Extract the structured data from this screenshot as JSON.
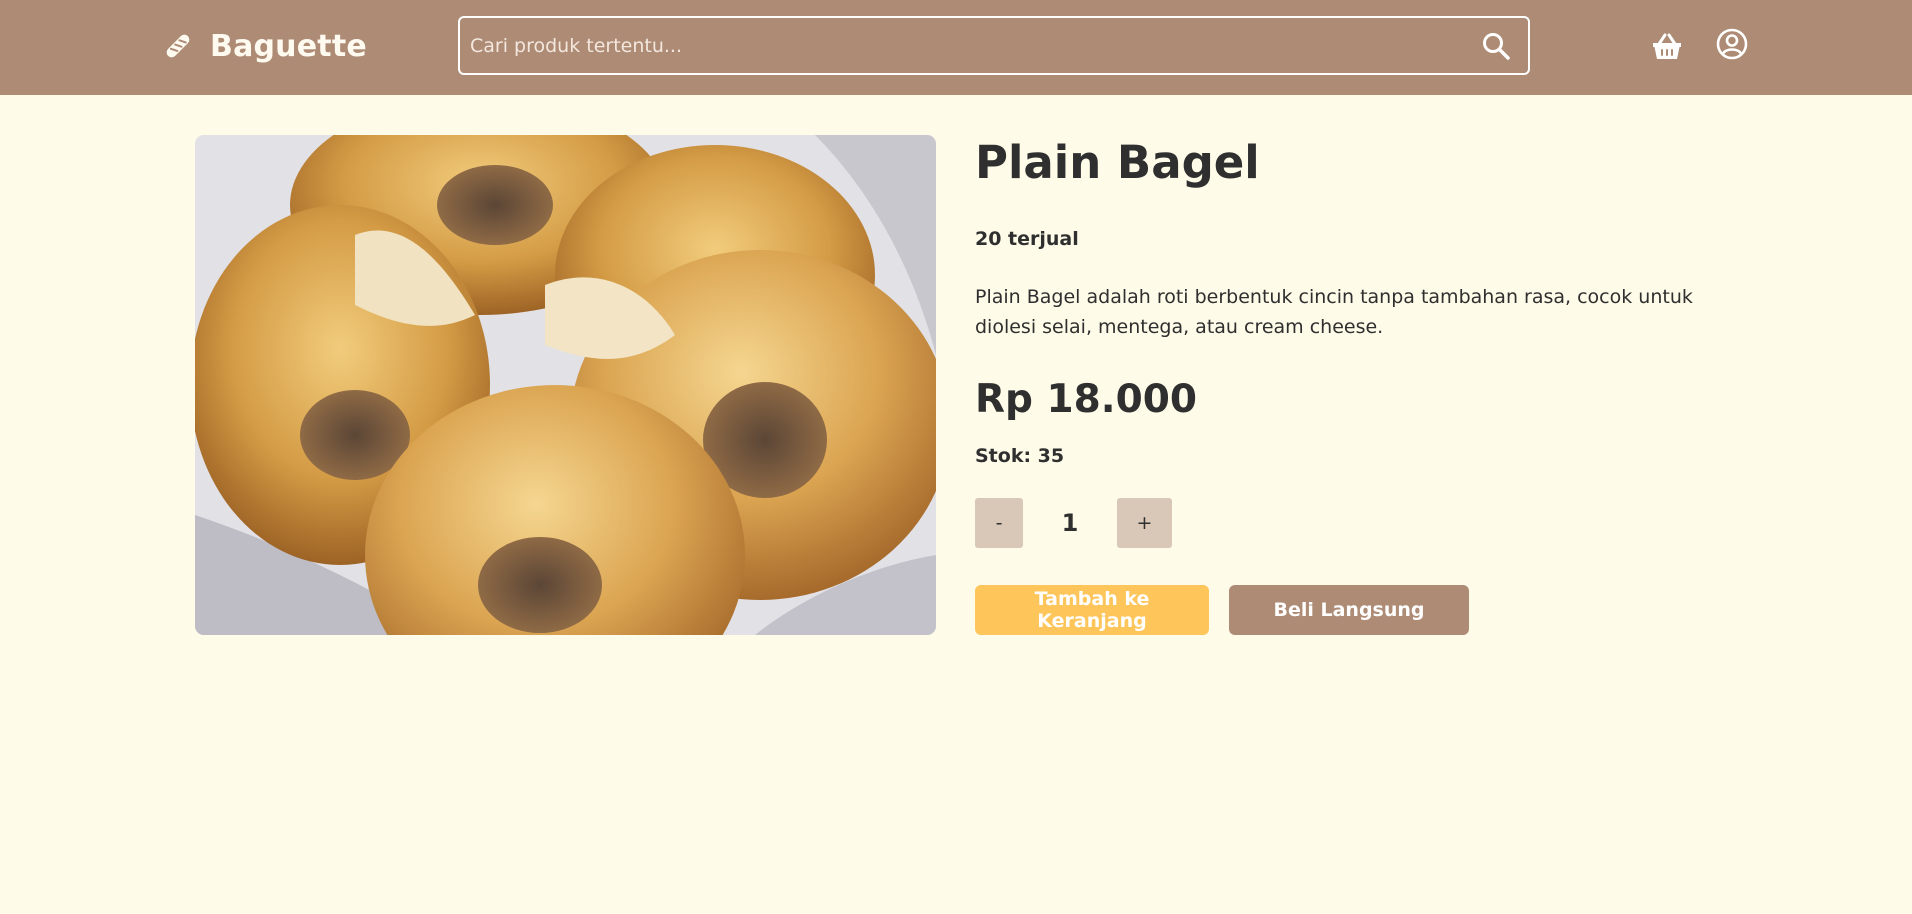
{
  "app": {
    "name": "Baguette",
    "logo_icon": "baguette-icon"
  },
  "colors": {
    "navbar": "#ad8b75",
    "background": "#fefbe8",
    "add_to_cart": "#fec55a",
    "buy_now": "#ad8b75",
    "qty_button": "#d9c8b7"
  },
  "header": {
    "search_placeholder": "Cari produk tertentu...",
    "search_icon": "search-icon",
    "cart_icon": "basket-icon",
    "account_icon": "user-circle-icon"
  },
  "product": {
    "image_subject": "bagels",
    "name": "Plain Bagel",
    "sold_text": "20 terjual",
    "description": "Plain Bagel adalah roti berbentuk cincin tanpa tambahan rasa, cocok untuk diolesi selai, mentega, atau cream cheese.",
    "price": "Rp 18.000",
    "stock_text": "Stok: 35",
    "quantity": {
      "decrement_label": "-",
      "value": "1",
      "increment_label": "+"
    },
    "add_to_cart_label": "Tambah ke Keranjang",
    "buy_now_label": "Beli Langsung"
  }
}
